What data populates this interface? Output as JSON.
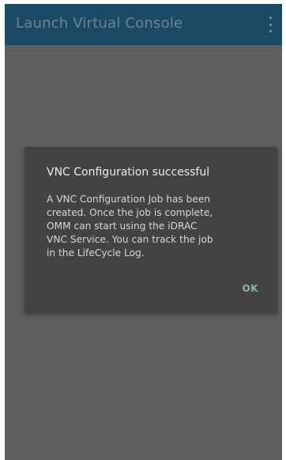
{
  "appbar": {
    "title": "Launch Virtual Console",
    "menu_icon": "overflow-menu-icon"
  },
  "dialog": {
    "title": "VNC Configuration successful",
    "message_lines": [
      "A VNC Configuration Job has been",
      "created. Once the job is complete,",
      "OMM can start using the iDRAC",
      "VNC Service. You can track the job",
      "in the LifeCycle Log."
    ],
    "ok_label": "OK"
  },
  "colors": {
    "appbar": "#1a4a66",
    "background": "#5e5e5e",
    "dialog": "#434343",
    "accent": "#86b7ad"
  }
}
